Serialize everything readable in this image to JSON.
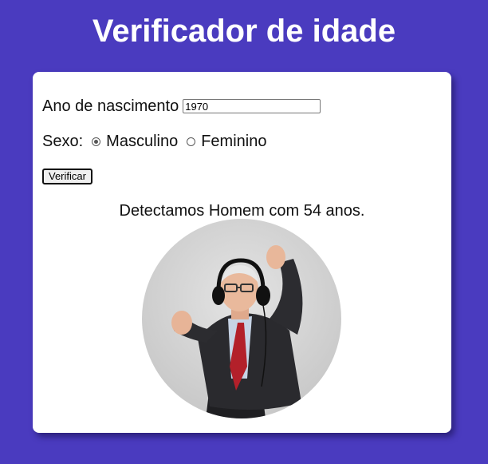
{
  "header": {
    "title": "Verificador de idade"
  },
  "form": {
    "birth_year_label": "Ano de nascimento",
    "birth_year_value": "1970",
    "sex_label": "Sexo:",
    "sex_options": [
      {
        "label": "Masculino",
        "checked": true
      },
      {
        "label": "Feminino",
        "checked": false
      }
    ],
    "submit_label": "Verificar"
  },
  "result": {
    "text": "Detectamos Homem com 54 anos.",
    "image_subject": "older man wearing headphones dancing"
  },
  "colors": {
    "background": "#4a3bbf",
    "card": "#ffffff",
    "title_text": "#ffffff"
  }
}
